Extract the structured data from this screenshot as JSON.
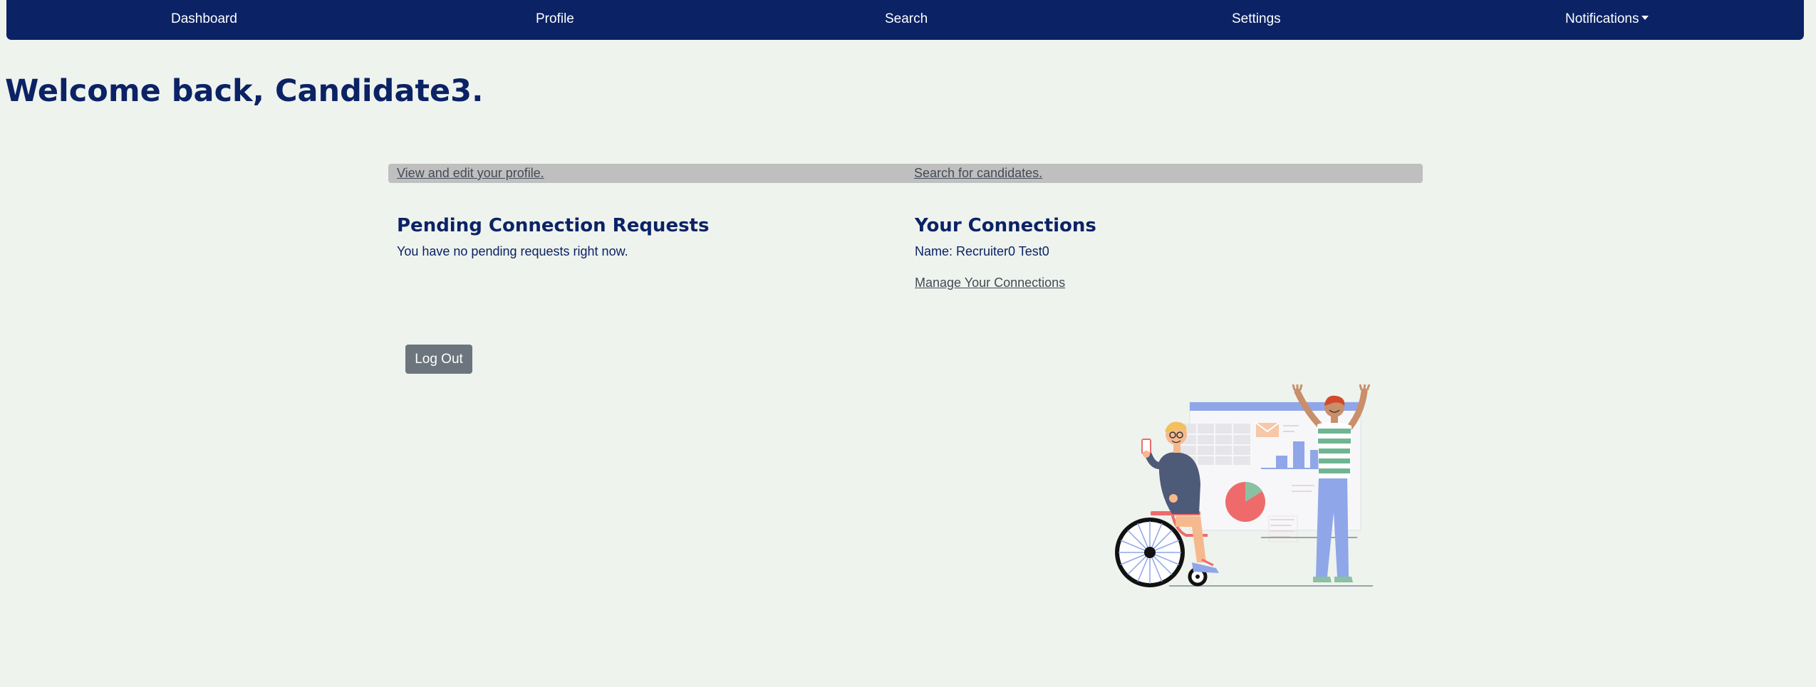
{
  "nav": {
    "items": [
      {
        "label": "Dashboard"
      },
      {
        "label": "Profile"
      },
      {
        "label": "Search"
      },
      {
        "label": "Settings"
      },
      {
        "label": "Notifications"
      }
    ]
  },
  "page": {
    "welcome": "Welcome back, Candidate3."
  },
  "quick_links": {
    "profile": "View and edit your profile.",
    "search": "Search for candidates."
  },
  "pending": {
    "title": "Pending Connection Requests",
    "empty_message": "You have no pending requests right now."
  },
  "connections": {
    "title": "Your Connections",
    "items": [
      {
        "text": "Name: Recruiter0 Test0"
      }
    ],
    "manage_label": "Manage Your Connections"
  },
  "actions": {
    "logout_label": "Log Out"
  },
  "colors": {
    "navy": "#0b2265",
    "background": "#eef3ee",
    "link_bar": "#bfbfbf",
    "button": "#6c757d"
  }
}
